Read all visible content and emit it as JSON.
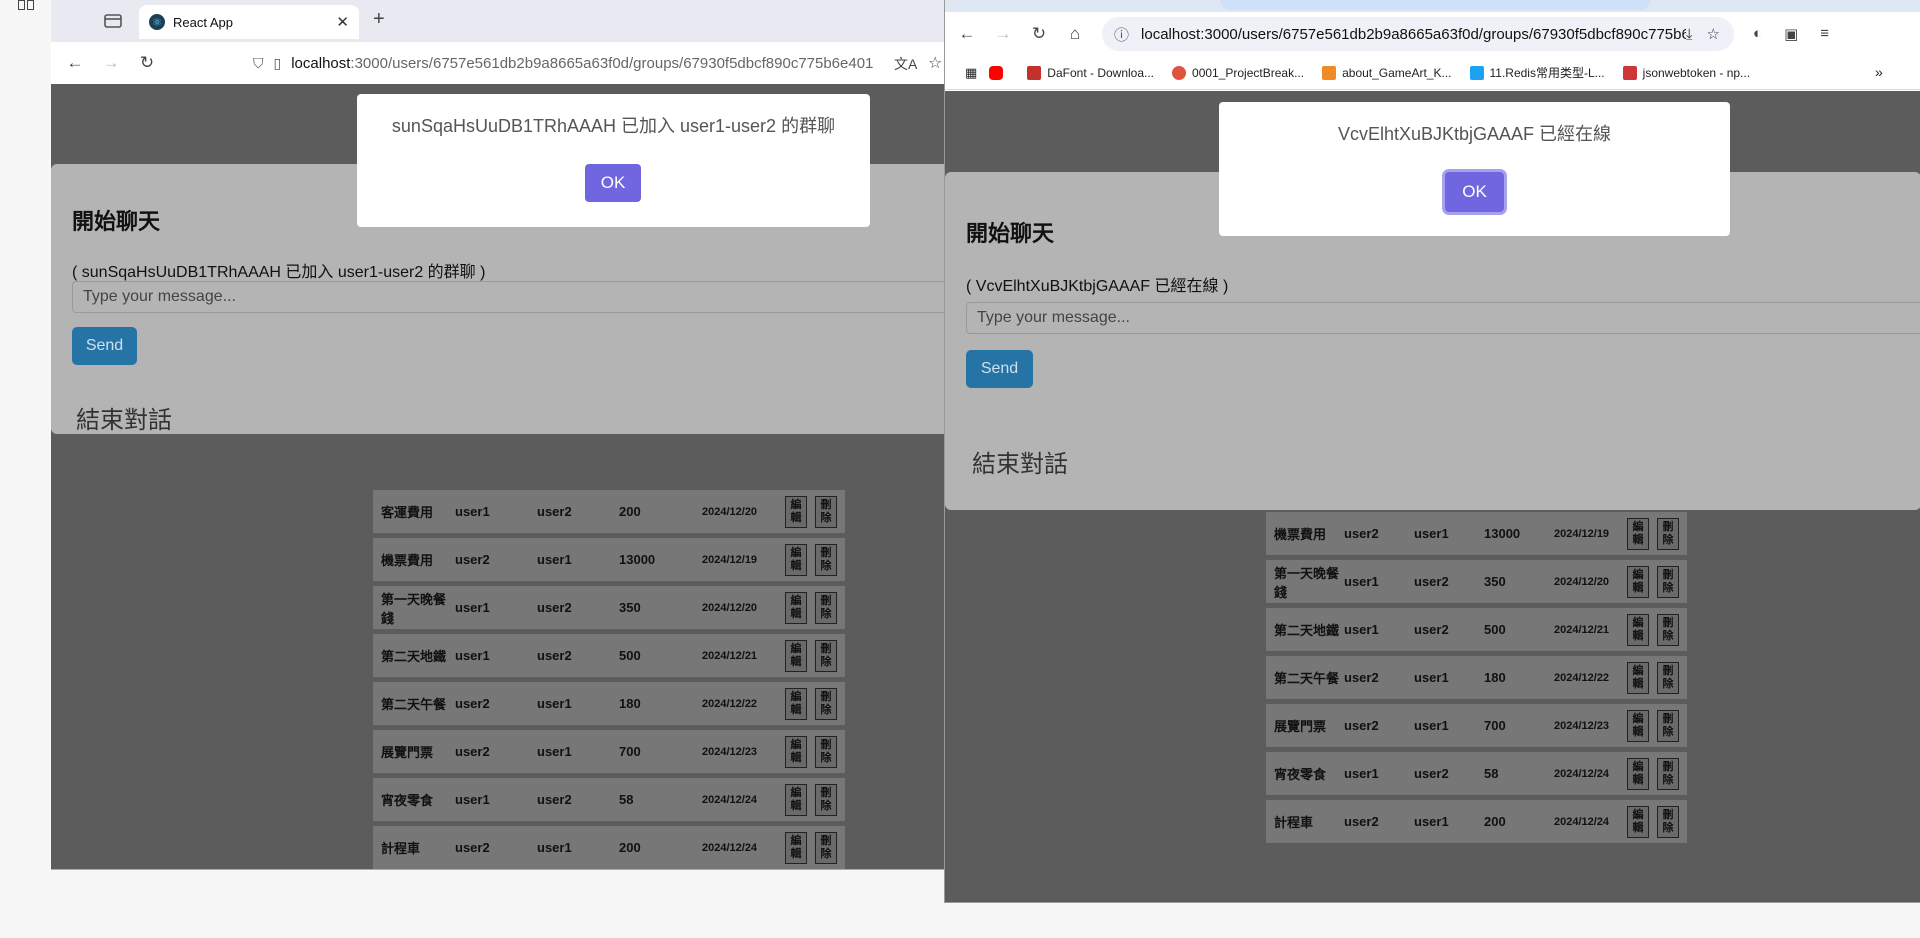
{
  "left_window": {
    "tab_title": "React App",
    "url_host": "localhost",
    "url_path": ":3000/users/6757e561db2b9a8665a63f0d/groups/67930f5dbcf890c775b6e401",
    "chat": {
      "title": "開始聊天",
      "note": "( sunSqaHsUuDB1TRhAAAH 已加入 user1-user2 的群聊 )",
      "input_placeholder": "Type your message...",
      "send_label": "Send",
      "end_label": "結束對話"
    },
    "modal": {
      "message": "sunSqaHsUuDB1TRhAAAH 已加入 user1-user2 的群聊",
      "ok_label": "OK"
    },
    "rows": [
      {
        "item": "客運費用",
        "payer": "user1",
        "payee": "user2",
        "amount": "200",
        "date": "2024/12/20"
      },
      {
        "item": "機票費用",
        "payer": "user2",
        "payee": "user1",
        "amount": "13000",
        "date": "2024/12/19"
      },
      {
        "item": "第一天晚餐錢",
        "payer": "user1",
        "payee": "user2",
        "amount": "350",
        "date": "2024/12/20"
      },
      {
        "item": "第二天地鐵",
        "payer": "user1",
        "payee": "user2",
        "amount": "500",
        "date": "2024/12/21"
      },
      {
        "item": "第二天午餐",
        "payer": "user2",
        "payee": "user1",
        "amount": "180",
        "date": "2024/12/22"
      },
      {
        "item": "展覽門票",
        "payer": "user2",
        "payee": "user1",
        "amount": "700",
        "date": "2024/12/23"
      },
      {
        "item": "宵夜零食",
        "payer": "user1",
        "payee": "user2",
        "amount": "58",
        "date": "2024/12/24"
      },
      {
        "item": "計程車",
        "payer": "user2",
        "payee": "user1",
        "amount": "200",
        "date": "2024/12/24"
      }
    ],
    "edit_label": "編輯",
    "delete_label": "刪除"
  },
  "right_window": {
    "url": "localhost:3000/users/6757e561db2b9a8665a63f0d/groups/67930f5dbcf890c775b6e4...",
    "bookmarks": [
      {
        "label": "DaFont - Downloa...",
        "color": "#c4302b"
      },
      {
        "label": "0001_ProjectBreak...",
        "color": "#e0533d"
      },
      {
        "label": "about_GameArt_K...",
        "color": "#f08a24"
      },
      {
        "label": "11.Redis常用类型-L...",
        "color": "#1da1f2"
      },
      {
        "label": "jsonwebtoken - np...",
        "color": "#cb3837"
      }
    ],
    "chat": {
      "title": "開始聊天",
      "note": "( VcvElhtXuBJKtbjGAAAF 已經在線 )",
      "input_placeholder": "Type your message...",
      "send_label": "Send",
      "end_label": "結束對話"
    },
    "modal": {
      "message": "VcvElhtXuBJKtbjGAAAF 已經在線",
      "ok_label": "OK"
    },
    "rows": [
      {
        "item": "機票費用",
        "payer": "user2",
        "payee": "user1",
        "amount": "13000",
        "date": "2024/12/19"
      },
      {
        "item": "第一天晚餐錢",
        "payer": "user1",
        "payee": "user2",
        "amount": "350",
        "date": "2024/12/20"
      },
      {
        "item": "第二天地鐵",
        "payer": "user1",
        "payee": "user2",
        "amount": "500",
        "date": "2024/12/21"
      },
      {
        "item": "第二天午餐",
        "payer": "user2",
        "payee": "user1",
        "amount": "180",
        "date": "2024/12/22"
      },
      {
        "item": "展覽門票",
        "payer": "user2",
        "payee": "user1",
        "amount": "700",
        "date": "2024/12/23"
      },
      {
        "item": "宵夜零食",
        "payer": "user1",
        "payee": "user2",
        "amount": "58",
        "date": "2024/12/24"
      },
      {
        "item": "計程車",
        "payer": "user2",
        "payee": "user1",
        "amount": "200",
        "date": "2024/12/24"
      }
    ],
    "edit_label": "編輯",
    "delete_label": "刪除"
  }
}
